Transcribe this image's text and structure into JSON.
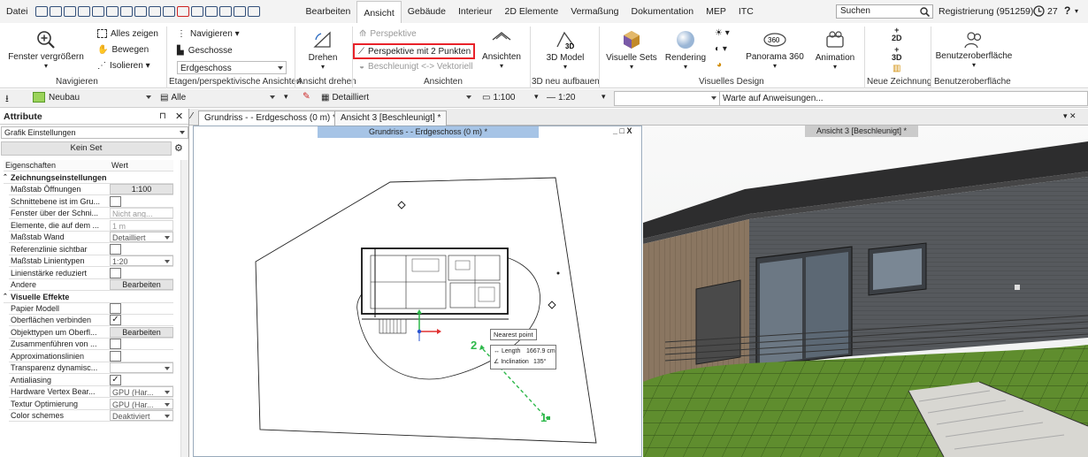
{
  "menubar": {
    "datei": "Datei",
    "tabs": [
      "Bearbeiten",
      "Ansicht",
      "Gebäude",
      "Interieur",
      "2D Elemente",
      "Vermaßung",
      "Dokumentation",
      "MEP",
      "ITC"
    ],
    "search_placeholder": "Suchen",
    "registration": "Registrierung (951259)",
    "clock_value": "27",
    "help": "?"
  },
  "ribbon": {
    "fenster_vergroessern": "Fenster vergrößern",
    "alles_zeigen": "Alles zeigen",
    "bewegen": "Bewegen",
    "isolieren": "Isolieren",
    "navigieren_btn": "Navigieren",
    "geschosse": "Geschosse",
    "erdgeschoss": "Erdgeschoss",
    "drehen": "Drehen",
    "perspektive": "Perspektive",
    "perspektive_2p": "Perspektive mit 2 Punkten",
    "beschleunigt": "Beschleunigt <-> Vektoriell",
    "ansichten": "Ansichten",
    "model_3d": "3D Model",
    "visuelle_sets": "Visuelle Sets",
    "rendering": "Rendering",
    "panorama": "Panorama 360",
    "animation": "Animation",
    "benutzeroberflaeche": "Benutzeroberfläche",
    "groups": {
      "navigieren": "Navigieren",
      "etagen": "Etagen/perspektivische Ansichten",
      "ansicht_drehen": "Ansicht drehen",
      "ansichten": "Ansichten",
      "neu_3d": "3D neu aufbauen",
      "visuelles_design": "Visuelles Design",
      "neue_zeichnung": "Neue Zeichnung",
      "benutzeroberflaeche": "Benutzeroberfläche"
    },
    "highlight_color": "#e8222a"
  },
  "toolbar": {
    "layer": "Neubau",
    "alle": "Alle",
    "detail": "Detailliert",
    "scale1": "1:100",
    "scale2": "1:20",
    "status": "Warte auf Anweisungen..."
  },
  "attributes": {
    "title": "Attribute",
    "pin_icon": "pin-icon",
    "close_icon": "close-icon",
    "dropdown": "Grafik Einstellungen",
    "set": "Kein Set",
    "col_prop": "Eigenschaften",
    "col_val": "Wert",
    "sections": [
      "Zeichnungseinstellungen",
      "Visuelle Effekte"
    ],
    "rows": [
      {
        "k": "Maßstab Öffnungen",
        "v": "1:100",
        "t": "btn"
      },
      {
        "k": "Schnittebene ist im Gru...",
        "v": "",
        "t": "chk"
      },
      {
        "k": "Fenster über der Schni...",
        "v": "Nicht ang...",
        "t": "ro"
      },
      {
        "k": "Elemente, die auf dem ...",
        "v": "1 m",
        "t": "ro"
      },
      {
        "k": "Maßstab Wand",
        "v": "Detailliert",
        "t": "drop"
      },
      {
        "k": "Referenzlinie sichtbar",
        "v": "",
        "t": "chk"
      },
      {
        "k": "Maßstab Linientypen",
        "v": "1:20",
        "t": "drop"
      },
      {
        "k": "Linienstärke reduziert",
        "v": "",
        "t": "chk"
      },
      {
        "k": "Andere",
        "v": "Bearbeiten",
        "t": "btn"
      },
      {
        "k": "Papier Modell",
        "v": "",
        "t": "chk"
      },
      {
        "k": "Oberflächen verbinden",
        "v": "✓",
        "t": "chk"
      },
      {
        "k": "Objekttypen um Oberfl...",
        "v": "Bearbeiten",
        "t": "btn"
      },
      {
        "k": "Zusammenführen von ...",
        "v": "",
        "t": "chk"
      },
      {
        "k": "Approximationslinien",
        "v": "",
        "t": "chk"
      },
      {
        "k": "Transparenz dynamisc...",
        "v": "",
        "t": "drop"
      },
      {
        "k": "Antialiasing",
        "v": "✓",
        "t": "chk"
      },
      {
        "k": "Hardware Vertex Bear...",
        "v": "GPU (Har...",
        "t": "drop"
      },
      {
        "k": "Textur Optimierung",
        "v": "GPU (Har...",
        "t": "drop"
      },
      {
        "k": "Color schemes",
        "v": "Deaktiviert",
        "t": "drop"
      }
    ]
  },
  "tabs": {
    "tab1": "Grundriss -  - Erdgeschoss (0 m) *",
    "tab2": "Ansicht 3 [Beschleunigt] *"
  },
  "viewport1": {
    "title": "Grundriss -  - Erdgeschoss (0 m) *",
    "controls": "_ □ X",
    "tooltip_title": "Nearest point",
    "length_label": "Length",
    "length_value": "1667.9 cm",
    "inclination_label": "Inclination",
    "inclination_value": "135°",
    "marker1": "1",
    "marker2": "2",
    "marker_color": "#2db84a"
  },
  "viewport2": {
    "title": "Ansicht 3 [Beschleunigt] *"
  }
}
